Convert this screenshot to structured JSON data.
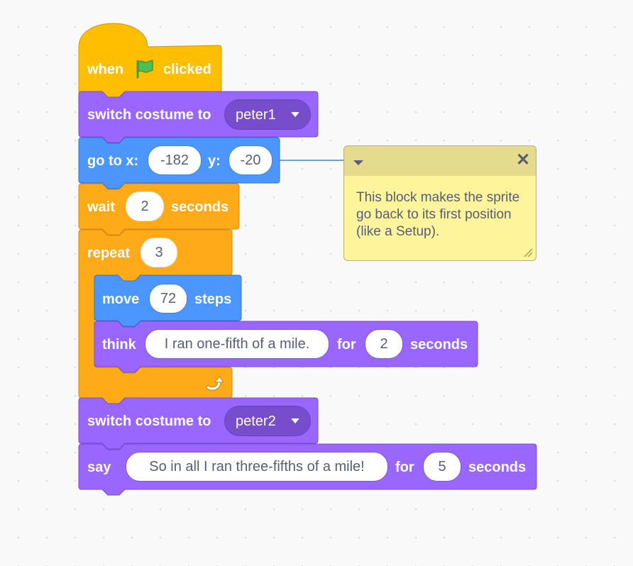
{
  "script": {
    "hat": {
      "when_label": "when",
      "clicked_label": "clicked",
      "flag_icon": "green-flag-icon"
    },
    "switch_costume_1": {
      "label": "switch costume to",
      "costume": "peter1"
    },
    "go_to": {
      "label_x": "go to x:",
      "x_value": "-182",
      "label_y": "y:",
      "y_value": "-20"
    },
    "wait": {
      "label": "wait",
      "value": "2",
      "unit": "seconds"
    },
    "repeat": {
      "label": "repeat",
      "count": "3",
      "loop_icon": "loop-arrow-icon"
    },
    "move": {
      "label": "move",
      "value": "72",
      "unit": "steps"
    },
    "think": {
      "label": "think",
      "message": "I ran one-fifth of a mile.",
      "for_label": "for",
      "seconds": "2",
      "unit": "seconds"
    },
    "switch_costume_2": {
      "label": "switch costume to",
      "costume": "peter2"
    },
    "say": {
      "label": "say",
      "message": "So in all I ran three-fifths of a mile!",
      "for_label": "for",
      "seconds": "5",
      "unit": "seconds"
    }
  },
  "comment": {
    "text": "This block makes the sprite go back to its first position (like a Setup).",
    "close_icon": "close-icon",
    "collapse_icon": "chevron-down-icon",
    "resize_icon": "resize-handle-icon"
  },
  "colors": {
    "events": "#ffbf00",
    "looks": "#9966ff",
    "motion": "#4c97ff",
    "control": "#ffab19",
    "comment": "#fef49c",
    "background": "#f9f9f9"
  }
}
